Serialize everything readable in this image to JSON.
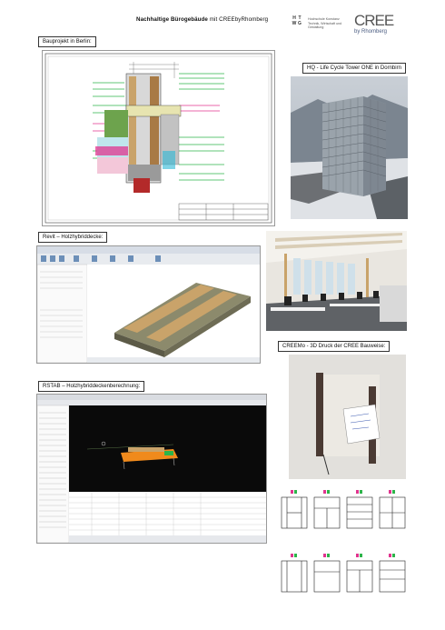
{
  "header": {
    "title_bold": "Nachhaltige Bürogebäude",
    "title_rest": " mit CREEbyRhomberg"
  },
  "htwg": {
    "letters": [
      "H",
      "T",
      "W",
      "G"
    ],
    "text": [
      "Hochschule Konstanz",
      "Technik, Wirtschaft und Gestaltung"
    ]
  },
  "cree": {
    "logo": "CREE",
    "sub": "by Rhomberg"
  },
  "sections": {
    "bauprojekt": "Bauprojekt in Berlin:",
    "hq": "HQ - Life Cycle Tower ONE in Dornbirn",
    "revit": "Revit – Holzhybriddecke:",
    "rstab": "RSTAB – Holzhybriddeckenberechnung:",
    "creemo": "CREEMo - 3D Druck der CREE Bauweise:"
  },
  "colors": {
    "green": "#2db44a",
    "magenta": "#e0348f",
    "cyan": "#2bb7d6",
    "wood": "#c9a36a",
    "orange": "#f08a1c"
  }
}
